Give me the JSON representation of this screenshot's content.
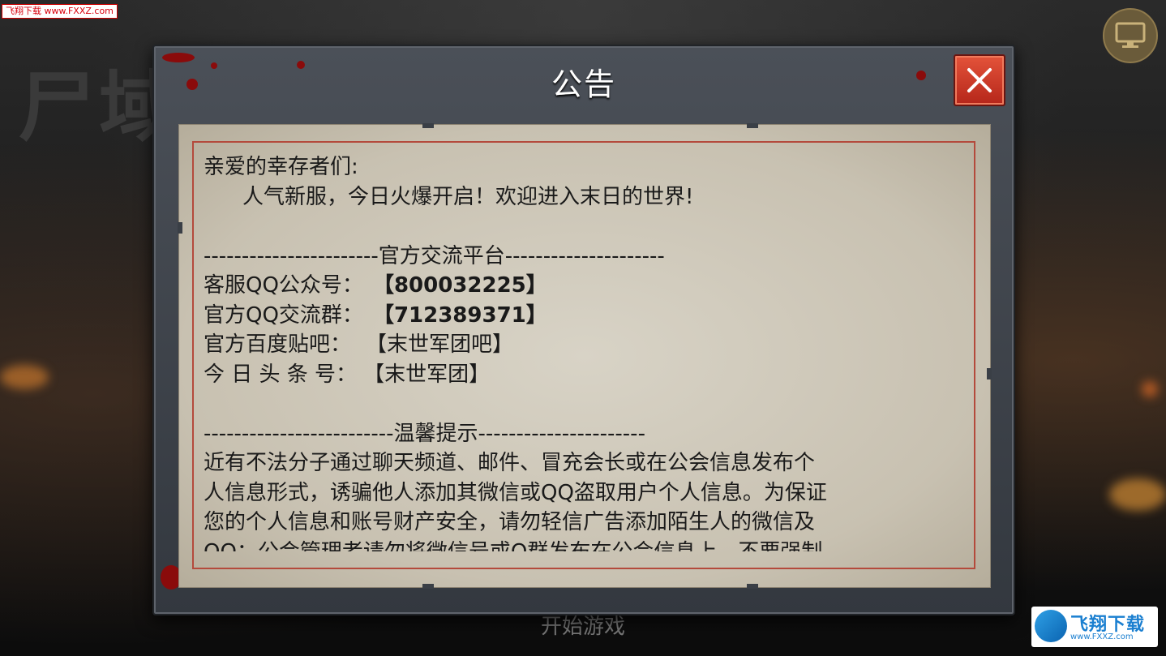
{
  "watermark": {
    "top_left": "飞翔下载 www.FXXZ.com",
    "bottom_right_name": "飞翔下载",
    "bottom_right_url": "www.FXXZ.com"
  },
  "background": {
    "logo_text": "尸域",
    "start_label": "开始游戏"
  },
  "dialog": {
    "title": "公告",
    "close_icon": "close-icon",
    "greeting": "亲爱的幸存者们:",
    "intro": "人气新服，今日火爆开启！欢迎进入末日的世界!",
    "section1_header": "-----------------------官方交流平台---------------------",
    "contacts": [
      {
        "label": "客服QQ公众号：",
        "value": "【800032225】"
      },
      {
        "label": "官方QQ交流群：",
        "value": "【712389371】"
      },
      {
        "label": "官方百度贴吧：",
        "value": "【末世军团吧】"
      },
      {
        "label": "今 日 头 条 号：",
        "value": "【末世军团】"
      }
    ],
    "section2_header": "-------------------------温馨提示----------------------",
    "tips": [
      "近有不法分子通过聊天频道、邮件、冒充会长或在公会信息发布个",
      "人信息形式，诱骗他人添加其微信或QQ盗取用户个人信息。为保证",
      "您的个人信息和账号财产安全，请勿轻信广告添加陌生人的微信及",
      "QQ；公会管理者请勿将微信号或Q群发布在公会信息上，不要强制"
    ]
  },
  "icons": {
    "monitor": "monitor-icon"
  }
}
